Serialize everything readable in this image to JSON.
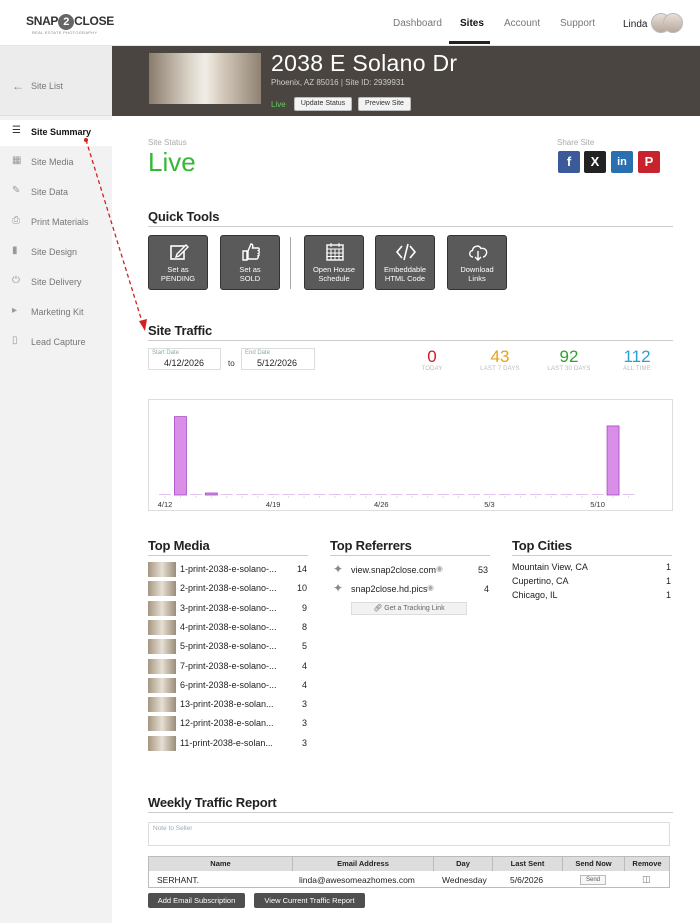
{
  "app": {
    "logo_left": "SNAP",
    "logo_two": "2",
    "logo_right": "CLOSE",
    "logo_tagline": "REAL ESTATE PHOTOGRAPHY"
  },
  "nav": {
    "items": [
      "Dashboard",
      "Sites",
      "Account",
      "Support"
    ],
    "active": "Sites",
    "user": "Linda"
  },
  "sidebar": {
    "back": "Site List",
    "items": [
      {
        "label": "Site Summary",
        "icon": "list-icon",
        "active": true
      },
      {
        "label": "Site Media",
        "icon": "images-icon"
      },
      {
        "label": "Site Data",
        "icon": "edit-icon"
      },
      {
        "label": "Print Materials",
        "icon": "printer-icon"
      },
      {
        "label": "Site Design",
        "icon": "design-icon"
      },
      {
        "label": "Site Delivery",
        "icon": "power-icon"
      },
      {
        "label": "Marketing Kit",
        "icon": "megaphone-icon"
      },
      {
        "label": "Lead Capture",
        "icon": "phone-icon"
      }
    ]
  },
  "site": {
    "title": "2038 E Solano Dr",
    "subtitle": "Phoenix, AZ  85016 | Site ID: 2939931",
    "status_small": "Live",
    "update_button": "Update Status",
    "preview_button": "Preview Site"
  },
  "status": {
    "label": "Site Status",
    "value": "Live",
    "share_label": "Share Site"
  },
  "quick_tools": {
    "title": "Quick Tools",
    "tools": [
      {
        "line1": "Set as",
        "line2": "PENDING",
        "icon": "edit-icon"
      },
      {
        "line1": "Set as",
        "line2": "SOLD",
        "icon": "thumbs-up-icon"
      },
      {
        "line1": "Open House",
        "line2": "Schedule",
        "icon": "calendar-icon"
      },
      {
        "line1": "Embeddable",
        "line2": "HTML Code",
        "icon": "code-icon"
      },
      {
        "line1": "Download",
        "line2": "Links",
        "icon": "cloud-download-icon"
      }
    ]
  },
  "traffic": {
    "title": "Site Traffic",
    "start_label": "Start Date",
    "start_value": "4/12/2026",
    "to": "to",
    "end_label": "End Date",
    "end_value": "5/12/2026",
    "stats": [
      {
        "value": "0",
        "caption": "TODAY",
        "color": "#cc1f1f"
      },
      {
        "value": "43",
        "caption": "LAST 7 DAYS",
        "color": "#e5a21a"
      },
      {
        "value": "92",
        "caption": "LAST 30 DAYS",
        "color": "#2ea32e"
      },
      {
        "value": "112",
        "caption": "ALL TIME",
        "color": "#2a9fd6"
      }
    ]
  },
  "chart_data": {
    "type": "bar",
    "categories": [
      "4/12",
      "4/13",
      "4/14",
      "4/15",
      "4/16",
      "4/17",
      "4/18",
      "4/19",
      "4/20",
      "4/21",
      "4/22",
      "4/23",
      "4/24",
      "4/25",
      "4/26",
      "4/27",
      "4/28",
      "4/29",
      "4/30",
      "5/1",
      "5/2",
      "5/3",
      "5/4",
      "5/5",
      "5/6",
      "5/7",
      "5/8",
      "5/9",
      "5/10",
      "5/11",
      "5/12"
    ],
    "values": [
      0,
      42,
      0,
      1,
      0,
      0,
      0,
      0,
      0,
      0,
      0,
      0,
      0,
      0,
      0,
      0,
      0,
      0,
      0,
      0,
      0,
      0,
      0,
      0,
      0,
      0,
      0,
      0,
      0,
      37,
      0
    ],
    "tick_labels": [
      "4/12",
      "4/19",
      "4/26",
      "5/3",
      "5/10"
    ],
    "color": "#d98ee8",
    "ylim": [
      0,
      45
    ]
  },
  "top_media": {
    "title": "Top Media",
    "rows": [
      {
        "name": "1-print-2038-e-solano-...",
        "count": "14"
      },
      {
        "name": "2-print-2038-e-solano-...",
        "count": "10"
      },
      {
        "name": "3-print-2038-e-solano-...",
        "count": "9"
      },
      {
        "name": "4-print-2038-e-solano-...",
        "count": "8"
      },
      {
        "name": "5-print-2038-e-solano-...",
        "count": "5"
      },
      {
        "name": "7-print-2038-e-solano-...",
        "count": "4"
      },
      {
        "name": "6-print-2038-e-solano-...",
        "count": "4"
      },
      {
        "name": "13-print-2038-e-solan...",
        "count": "3"
      },
      {
        "name": "12-print-2038-e-solan...",
        "count": "3"
      },
      {
        "name": "11-print-2038-e-solan...",
        "count": "3"
      }
    ]
  },
  "top_referrers": {
    "title": "Top Referrers",
    "rows": [
      {
        "name": "view.snap2close.com",
        "count": "53"
      },
      {
        "name": "snap2close.hd.pics",
        "count": "4"
      }
    ],
    "tracking_button": "Get a Tracking Link"
  },
  "top_cities": {
    "title": "Top Cities",
    "rows": [
      {
        "name": "Mountain View, CA",
        "count": "1"
      },
      {
        "name": "Cupertino, CA",
        "count": "1"
      },
      {
        "name": "Chicago, IL",
        "count": "1"
      }
    ]
  },
  "weekly": {
    "title": "Weekly Traffic Report",
    "note_placeholder": "Note to Seller",
    "headers": [
      "Name",
      "Email Address",
      "Day",
      "Last Sent",
      "Send Now",
      "Remove"
    ],
    "row": {
      "name": "SERHANT.",
      "email": "linda@awesomeazhomes.com",
      "day": "Wednesday",
      "last_sent": "5/6/2026",
      "send": "Send"
    },
    "add_button": "Add Email Subscription",
    "view_button": "View Current Traffic Report"
  }
}
